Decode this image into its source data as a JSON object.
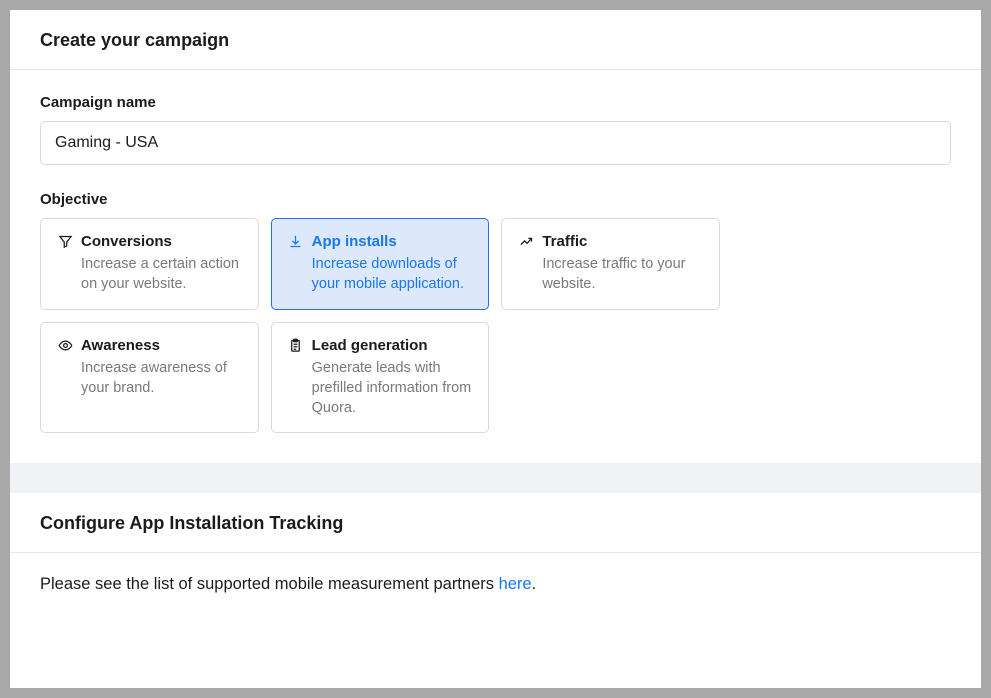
{
  "create_campaign": {
    "title": "Create your campaign",
    "name_label": "Campaign name",
    "name_value": "Gaming - USA",
    "objective_label": "Objective",
    "objectives": [
      {
        "id": "conversions",
        "title": "Conversions",
        "desc": "Increase a certain action on your website.",
        "selected": false
      },
      {
        "id": "app-installs",
        "title": "App installs",
        "desc": "Increase downloads of your mobile application.",
        "selected": true
      },
      {
        "id": "traffic",
        "title": "Traffic",
        "desc": "Increase traffic to your website.",
        "selected": false
      },
      {
        "id": "awareness",
        "title": "Awareness",
        "desc": "Increase awareness of your brand.",
        "selected": false
      },
      {
        "id": "lead-generation",
        "title": "Lead generation",
        "desc": "Generate leads with prefilled information from Quora.",
        "selected": false
      }
    ]
  },
  "tracking": {
    "title": "Configure App Installation Tracking",
    "body_prefix": "Please see the list of supported mobile measurement partners ",
    "link_text": "here",
    "body_suffix": "."
  }
}
